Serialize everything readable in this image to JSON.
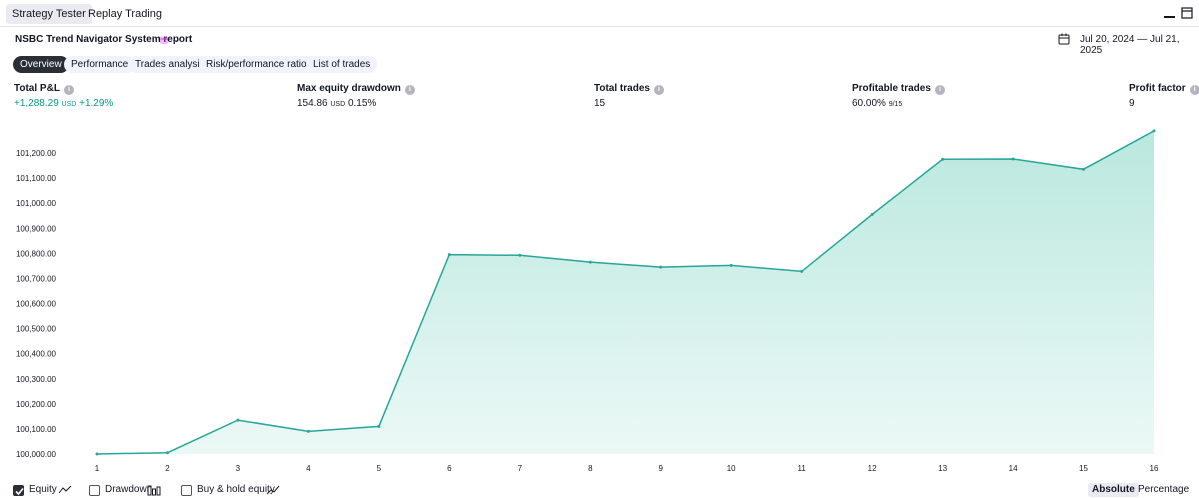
{
  "tabs": [
    {
      "label": "Strategy Tester"
    },
    {
      "label": "Replay Trading"
    }
  ],
  "report": {
    "title": "NSBC Trend Navigator System report",
    "date_range": "Jul 20, 2024 — Jul 21, 2025"
  },
  "subtabs": [
    {
      "label": "Overview"
    },
    {
      "label": "Performance"
    },
    {
      "label": "Trades analysis"
    },
    {
      "label": "Risk/performance ratios"
    },
    {
      "label": "List of trades"
    }
  ],
  "metrics": {
    "pnl": {
      "label": "Total P&L",
      "value": "+1,288.29",
      "unit": "USD",
      "pct": "+1.29%"
    },
    "drawdown": {
      "label": "Max equity drawdown",
      "value": "154.86",
      "unit": "USD",
      "pct": "0.15%"
    },
    "trades": {
      "label": "Total trades",
      "value": "15"
    },
    "profitable": {
      "label": "Profitable trades",
      "value": "60.00%",
      "sub": "9/15"
    },
    "factor": {
      "label": "Profit factor",
      "value": "9"
    }
  },
  "colors": {
    "accent": "#089981",
    "line": "#26a69a",
    "fill": "#b2e5db"
  },
  "legend": {
    "equity": "Equity",
    "drawdown": "Drawdown",
    "buyhold": "Buy & hold equity"
  },
  "modes": {
    "absolute": "Absolute",
    "percentage": "Percentage"
  },
  "chart_data": {
    "type": "area",
    "x": [
      1,
      2,
      3,
      4,
      5,
      6,
      7,
      8,
      9,
      10,
      11,
      12,
      13,
      14,
      15,
      16
    ],
    "series": [
      {
        "values": [
          100000,
          100005,
          100135,
          100090,
          100110,
          100795,
          100792,
          100765,
          100745,
          100752,
          100728,
          100955,
          101175,
          101176,
          101135,
          101288
        ]
      }
    ],
    "y_ticks": [
      "100,000.00",
      "100,100.00",
      "100,200.00",
      "100,300.00",
      "100,400.00",
      "100,500.00",
      "100,600.00",
      "100,700.00",
      "100,800.00",
      "100,900.00",
      "101,000.00",
      "101,100.00",
      "101,200.00"
    ],
    "ylim": [
      100000,
      101200
    ],
    "grid": false
  }
}
